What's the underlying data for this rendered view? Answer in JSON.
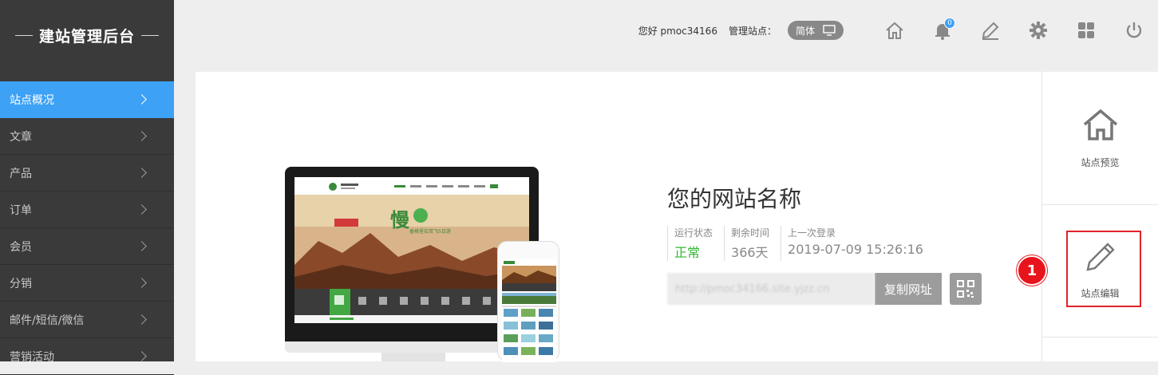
{
  "brand": {
    "title": "建站管理后台"
  },
  "sidebar": {
    "items": [
      {
        "label": "站点概况",
        "active": true
      },
      {
        "label": "文章"
      },
      {
        "label": "产品"
      },
      {
        "label": "订单"
      },
      {
        "label": "会员"
      },
      {
        "label": "分销"
      },
      {
        "label": "邮件/短信/微信"
      },
      {
        "label": "营销活动"
      }
    ]
  },
  "topbar": {
    "greeting": "您好 pmoc34166",
    "manage_label": "管理站点：",
    "lang_label": "简体",
    "notification_count": "0",
    "icons": [
      "home-icon",
      "bell-icon",
      "edit-icon",
      "gear-icon",
      "grid-icon",
      "power-icon"
    ]
  },
  "site": {
    "name": "您的网站名称",
    "stats": [
      {
        "label": "运行状态",
        "value": "正常"
      },
      {
        "label": "剩余时间",
        "value": "366天"
      },
      {
        "label": "上一次登录",
        "value": "2019-07-09 15:26:16"
      }
    ],
    "url": "http://pmoc34166.site.yjzz.cn",
    "copy_label": "复制网址"
  },
  "side_panel": {
    "preview_label": "站点预览",
    "edit_label": "站点编辑"
  },
  "annotation": {
    "step": "1"
  },
  "preview": {
    "banner_big": "慢",
    "banner_small": "香格里拉双飞5日游"
  },
  "colors": {
    "accent": "#3da1f5",
    "ok": "#2eb82e",
    "highlight": "#e0242a",
    "sidebar_bg": "#3a3a3a"
  }
}
